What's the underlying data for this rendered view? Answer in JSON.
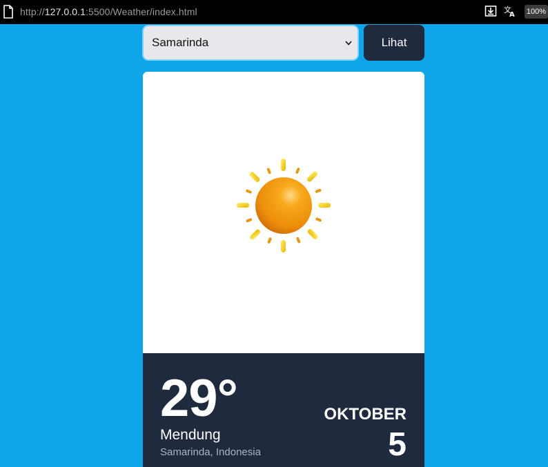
{
  "browser": {
    "url_prefix": "http://",
    "url_host": "127.0.0.1",
    "url_path": ":5500/Weather/index.html",
    "zoom": "100%",
    "icons": [
      "page-icon",
      "download-icon",
      "translate-icon"
    ]
  },
  "controls": {
    "city_selected": "Samarinda",
    "submit_label": "Lihat"
  },
  "weather": {
    "icon": "sun-icon",
    "temperature": "29°",
    "condition": "Mendung",
    "location": "Samarinda, Indonesia",
    "month": "OKTOBER",
    "day": "5"
  },
  "colors": {
    "page_background": "#0ea5e9",
    "card_dark": "#1f2a3e",
    "sun_orange": "#f59e0b",
    "ray_yellow": "#f5d000"
  }
}
